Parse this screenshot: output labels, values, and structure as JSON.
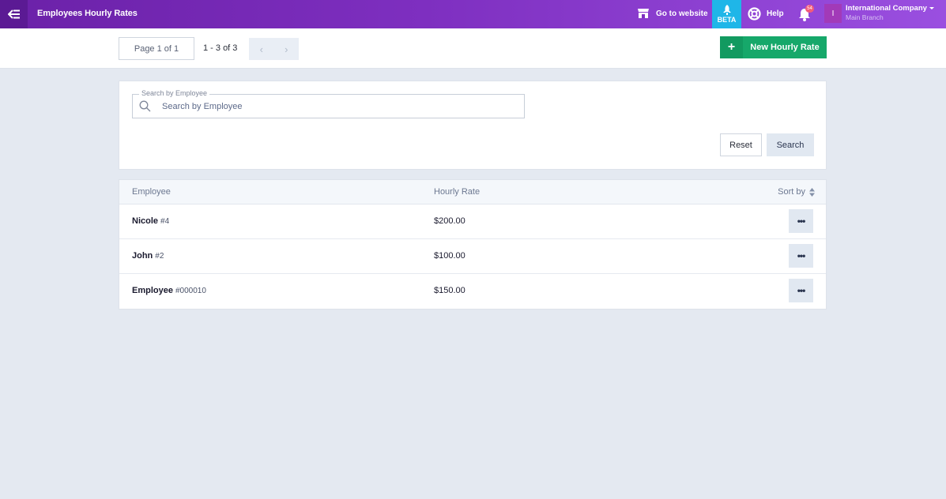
{
  "header": {
    "page_title": "Employees Hourly Rates",
    "go_to_website": "Go to website",
    "beta_label": "BETA",
    "help_label": "Help",
    "notification_count": "54",
    "account": {
      "avatar_letter": "I",
      "company": "International Company",
      "branch": "Main Branch"
    }
  },
  "toolbar": {
    "page_indicator": "Page 1 of 1",
    "range_text": "1 - 3 of 3",
    "prev_icon": "chevron-left-icon",
    "next_icon": "chevron-right-icon",
    "new_button_label": "New Hourly Rate"
  },
  "search": {
    "legend": "Search by Employee",
    "placeholder": "Search by Employee",
    "value": "",
    "reset_label": "Reset",
    "search_label": "Search"
  },
  "table": {
    "columns": {
      "employee": "Employee",
      "hourly_rate": "Hourly Rate",
      "sort_by": "Sort by"
    },
    "rows": [
      {
        "name": "Nicole",
        "id": "#4",
        "rate": "$200.00",
        "action": "•••"
      },
      {
        "name": "John",
        "id": "#2",
        "rate": "$100.00",
        "action": "•••"
      },
      {
        "name": "Employee",
        "id": "#000010",
        "rate": "$150.00",
        "action": "•••"
      }
    ]
  },
  "colors": {
    "header_gradient_start": "#6b21a8",
    "header_gradient_end": "#9a4fe0",
    "beta_bg": "#1fb6e8",
    "primary_action": "#16a86a",
    "page_bg": "#e4e9f1"
  }
}
